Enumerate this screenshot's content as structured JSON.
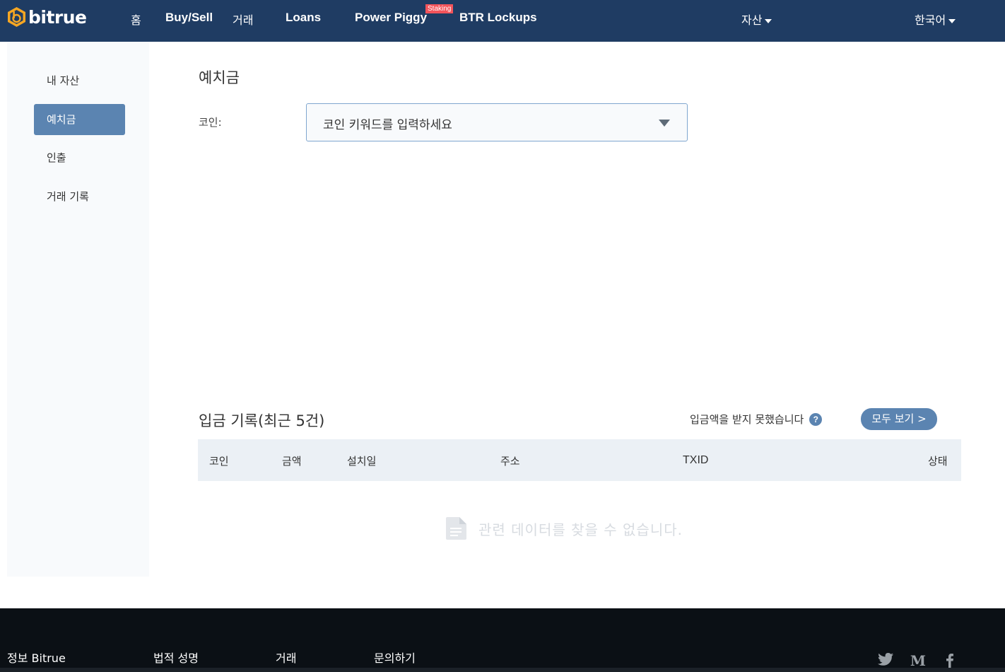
{
  "header": {
    "brand": "bitrue",
    "nav": {
      "home": "홈",
      "buy_sell": "Buy/Sell",
      "trade": "거래",
      "loans": "Loans",
      "power_piggy": "Power Piggy",
      "staking_badge": "Staking",
      "btr_lockups": "BTR Lockups"
    },
    "assets_menu": "자산",
    "language": "한국어"
  },
  "sidebar": {
    "items": [
      {
        "label": "내 자산",
        "active": false
      },
      {
        "label": "예치금",
        "active": true
      },
      {
        "label": "인출",
        "active": false
      },
      {
        "label": "거래 기록",
        "active": false
      }
    ]
  },
  "main": {
    "title": "예치금",
    "coin_label": "코인:",
    "coin_select_placeholder": "코인 키워드를 입력하세요"
  },
  "records": {
    "title": "입금 기록(최근 5건)",
    "not_received": "입금액을 받지 못했습니다",
    "help": "?",
    "view_all": "모두 보기 >",
    "columns": [
      "코인",
      "금액",
      "설치일",
      "주소",
      "TXID",
      "상태"
    ],
    "empty_message": "관련 데이터를 찾을 수 없습니다."
  },
  "footer": {
    "links": [
      "정보 Bitrue",
      "법적 성명",
      "거래",
      "문의하기"
    ]
  },
  "colors": {
    "header_bg": "#1f3c63",
    "accent": "#5b84b1",
    "logo_gold": "#f5a623",
    "footer_bg": "#0b1015",
    "badge_red": "#f2545b"
  }
}
